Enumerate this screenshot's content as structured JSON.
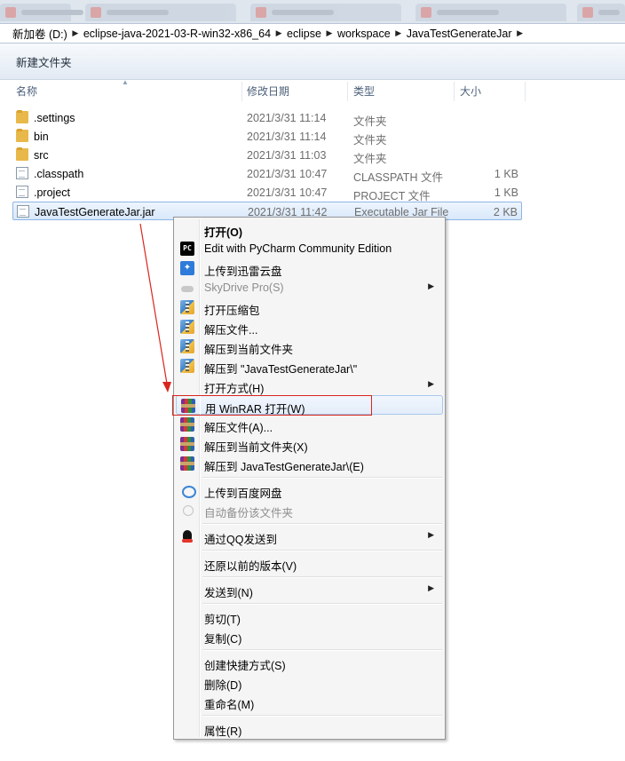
{
  "addressbar": {
    "crumbs": [
      "新加卷 (D:)",
      "eclipse-java-2021-03-R-win32-x86_64",
      "eclipse",
      "workspace",
      "JavaTestGenerateJar"
    ]
  },
  "toolbar": {
    "new_folder_label": "新建文件夹"
  },
  "columns": {
    "name": "名称",
    "date": "修改日期",
    "type": "类型",
    "size": "大小"
  },
  "files": [
    {
      "name": ".settings",
      "date": "2021/3/31 11:14",
      "type": "文件夹",
      "size": "",
      "icon": "folder-icon"
    },
    {
      "name": "bin",
      "date": "2021/3/31 11:14",
      "type": "文件夹",
      "size": "",
      "icon": "folder-icon"
    },
    {
      "name": "src",
      "date": "2021/3/31 11:03",
      "type": "文件夹",
      "size": "",
      "icon": "folder-icon"
    },
    {
      "name": ".classpath",
      "date": "2021/3/31 10:47",
      "type": "CLASSPATH 文件",
      "size": "1 KB",
      "icon": "file-icon"
    },
    {
      "name": ".project",
      "date": "2021/3/31 10:47",
      "type": "PROJECT 文件",
      "size": "1 KB",
      "icon": "file-icon"
    },
    {
      "name": "JavaTestGenerateJar.jar",
      "date": "2021/3/31 11:42",
      "type": "Executable Jar File",
      "size": "2 KB",
      "icon": "file-icon"
    }
  ],
  "context_menu": {
    "items": [
      {
        "label": "打开(O)",
        "icon": "",
        "bold": true
      },
      {
        "label": "Edit with PyCharm Community Edition",
        "icon": "pycharm-icon",
        "icon_text": "PC"
      },
      {
        "label": "上传到迅雷云盘",
        "icon": "xunlei-icon"
      },
      {
        "label": "SkyDrive Pro(S)",
        "icon": "cloud-icon",
        "disabled": true,
        "submenu": true
      },
      {
        "label": "打开压缩包",
        "icon": "zip-icon"
      },
      {
        "label": "解压文件...",
        "icon": "zip-icon"
      },
      {
        "label": "解压到当前文件夹",
        "icon": "zip-icon"
      },
      {
        "label": "解压到 \"JavaTestGenerateJar\\\"",
        "icon": "zip-icon"
      },
      {
        "label": "打开方式(H)",
        "icon": "",
        "submenu": true
      },
      {
        "label": "用 WinRAR 打开(W)",
        "icon": "winrar-icon",
        "highlighted": true
      },
      {
        "label": "解压文件(A)...",
        "icon": "winrar-icon"
      },
      {
        "label": "解压到当前文件夹(X)",
        "icon": "winrar-icon"
      },
      {
        "label": "解压到 JavaTestGenerateJar\\(E)",
        "icon": "winrar-icon"
      },
      {
        "label": "上传到百度网盘",
        "icon": "baidu-netdisk-icon"
      },
      {
        "label": "自动备份该文件夹",
        "icon": "backup-icon",
        "disabled": true
      },
      {
        "label": "通过QQ发送到",
        "icon": "qq-icon",
        "submenu": true
      },
      {
        "label": "还原以前的版本(V)",
        "icon": ""
      },
      {
        "label": "发送到(N)",
        "icon": "",
        "submenu": true
      },
      {
        "label": "剪切(T)",
        "icon": ""
      },
      {
        "label": "复制(C)",
        "icon": ""
      },
      {
        "label": "创建快捷方式(S)",
        "icon": ""
      },
      {
        "label": "删除(D)",
        "icon": ""
      },
      {
        "label": "重命名(M)",
        "icon": ""
      },
      {
        "label": "属性(R)",
        "icon": ""
      }
    ]
  },
  "colors": {
    "annotation": "#d9261c",
    "selection_border": "#8fb6e3",
    "menu_bg": "#f5f5f5"
  }
}
